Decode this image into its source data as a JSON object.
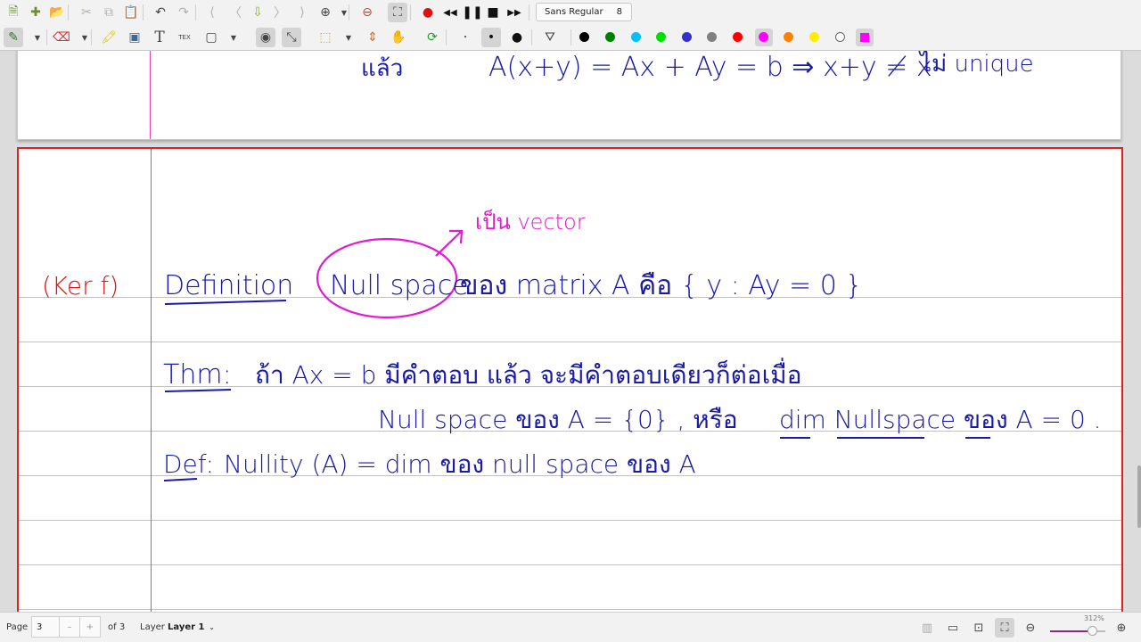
{
  "toolbar_top": {
    "buttons": [
      {
        "name": "new-document-icon",
        "glyph": "🗎"
      },
      {
        "name": "new-page-icon",
        "glyph": "✚"
      },
      {
        "name": "open-folder-icon",
        "glyph": "📂"
      },
      {
        "name": "cut-icon",
        "glyph": "✂"
      },
      {
        "name": "copy-icon",
        "glyph": "⧉"
      },
      {
        "name": "paste-icon",
        "glyph": "📋"
      },
      {
        "name": "undo-icon",
        "glyph": "↶"
      },
      {
        "name": "redo-icon",
        "glyph": "↷"
      },
      {
        "name": "first-page-icon",
        "glyph": "⟨"
      },
      {
        "name": "previous-page-icon",
        "glyph": "〈"
      },
      {
        "name": "goto-page-icon",
        "glyph": "⇩"
      },
      {
        "name": "next-page-icon",
        "glyph": "〉"
      },
      {
        "name": "last-page-icon",
        "glyph": "⟩"
      },
      {
        "name": "insert-page-icon",
        "glyph": "⊕"
      },
      {
        "name": "delete-page-icon",
        "glyph": "⊖"
      },
      {
        "name": "fullscreen-icon",
        "glyph": "⛶"
      },
      {
        "name": "record-icon",
        "glyph": "●"
      },
      {
        "name": "rewind-icon",
        "glyph": "◀◀"
      },
      {
        "name": "pause-icon",
        "glyph": "❚❚"
      },
      {
        "name": "stop-icon",
        "glyph": "■"
      },
      {
        "name": "fast-forward-icon",
        "glyph": "▶▶"
      }
    ],
    "font": {
      "name": "Sans Regular",
      "size": "8"
    }
  },
  "toolbar_tools": {
    "buttons": [
      {
        "name": "pen-tool-icon",
        "glyph": "✎"
      },
      {
        "name": "eraser-tool-icon",
        "glyph": "⌫"
      },
      {
        "name": "highlighter-tool-icon",
        "glyph": "🖍"
      },
      {
        "name": "image-tool-icon",
        "glyph": "▣"
      },
      {
        "name": "text-tool-icon",
        "glyph": "T"
      },
      {
        "name": "latex-tool-icon",
        "glyph": "TEX"
      },
      {
        "name": "shape-tool-icon",
        "glyph": "▢"
      },
      {
        "name": "shape-recognizer-icon",
        "glyph": "◉"
      },
      {
        "name": "ruler-tool-icon",
        "glyph": "⤡"
      },
      {
        "name": "select-rect-icon",
        "glyph": "⬚"
      },
      {
        "name": "vertical-space-icon",
        "glyph": "⇕"
      },
      {
        "name": "hand-tool-icon",
        "glyph": "✋"
      },
      {
        "name": "refresh-icon",
        "glyph": "⟳"
      },
      {
        "name": "fine-size-icon",
        "glyph": "·"
      },
      {
        "name": "medium-size-icon",
        "glyph": "•"
      },
      {
        "name": "thick-size-icon",
        "glyph": "●"
      },
      {
        "name": "fill-icon",
        "glyph": "⛛"
      }
    ],
    "colors": [
      "#000000",
      "#008000",
      "#00c0ff",
      "#00e000",
      "#3333cc",
      "#808080",
      "#ff0000",
      "#ff00ff",
      "#ff8000",
      "#ffee00",
      "#ffffff"
    ],
    "selected_color": "#ff00ff",
    "custom_color": "#ff00ff"
  },
  "notes": {
    "top_page": {
      "line1_left": "แล้ว",
      "line1_math": "A(x+y) = Ax + Ay = b  ⇒  x+y ≠ x",
      "line1_tail": "ไม่ unique"
    },
    "page": {
      "annotation": "เป็น vector",
      "margin_note": "(Ker f)",
      "definition_label": "Definition",
      "null_space": "Null space",
      "definition_text": "ของ matrix A คือ { y : Ay = 0 }",
      "thm_label": "Thm:",
      "thm_line1": "ถ้า Ax = b มีคำตอบ แล้ว จะมีคำตอบเดียวก็ต่อเมื่อ",
      "thm_line2_a": "Null space ของ A = {0} , หรือ",
      "thm_line2_b": "dim Nullspace ของ A = 0 .",
      "def_label": "Def:",
      "def_text": "Nullity (A) = dim ของ null space ของ A"
    },
    "ink_colors": {
      "blue": "#1a1aa6",
      "magenta": "#e21bd0",
      "red": "#e01010"
    }
  },
  "statusbar": {
    "page_label": "Page",
    "page_value": "3",
    "minus": "–",
    "plus": "+",
    "of_pages": "of 3",
    "layer_label": "Layer",
    "layer_value": "Layer 1",
    "zoom": "312%"
  }
}
